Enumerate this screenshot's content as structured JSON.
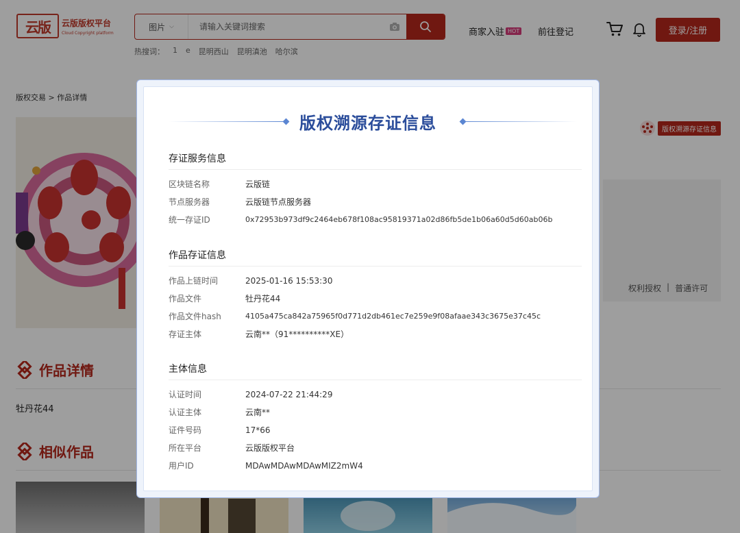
{
  "header": {
    "logo_seal": "云版",
    "logo_name": "云版版权平台",
    "logo_en": "Cloud Copyright platform",
    "search_category": "图片",
    "search_placeholder": "请输入关键词搜索",
    "hot_label": "热搜词：",
    "hot_words": [
      "1",
      "e",
      "昆明西山",
      "昆明滇池",
      "哈尔滨"
    ],
    "merchant_label": "商家入驻",
    "hot_badge": "HOT",
    "register_label": "前往登记",
    "login_label": "登录/注册"
  },
  "breadcrumb": "版权交易 > 作品详情",
  "trace_tag": "版权溯源存证信息",
  "license_links": [
    "权利授权",
    "|",
    "普通许可"
  ],
  "sections": {
    "detail_title": "作品详情",
    "work_name": "牡丹花44",
    "similar_title": "相似作品"
  },
  "modal": {
    "title": "版权溯源存证信息",
    "groups": [
      {
        "title": "存证服务信息",
        "rows": [
          {
            "k": "区块链名称",
            "v": "云版链"
          },
          {
            "k": "节点服务器",
            "v": "云版链节点服务器"
          },
          {
            "k": "统一存证ID",
            "v": "0x72953b973df9c2464eb678f108ac95819371a02d86fb5de1b06a60d5d60ab06b"
          }
        ]
      },
      {
        "title": "作品存证信息",
        "rows": [
          {
            "k": "作品上链时间",
            "v": "2025-01-16 15:53:30"
          },
          {
            "k": "作品文件",
            "v": "牡丹花44"
          },
          {
            "k": "作品文件hash",
            "v": "4105a475ca842a75965f0d771d2db461ec7e259e9f08afaae343c3675e37c45c"
          },
          {
            "k": "存证主体",
            "v": "云南**（91**********XE）"
          }
        ]
      },
      {
        "title": "主体信息",
        "rows": [
          {
            "k": "认证时间",
            "v": "2024-07-22 21:44:29"
          },
          {
            "k": "认证主体",
            "v": "云南**"
          },
          {
            "k": "证件号码",
            "v": "17*66"
          },
          {
            "k": "所在平台",
            "v": "云版版权平台"
          },
          {
            "k": "用户ID",
            "v": "MDAwMDAwMDAwMIZ2mW4"
          }
        ]
      }
    ]
  },
  "colors": {
    "brand_red": "#b5281c",
    "modal_title_blue": "#2b4d9b",
    "accent_blue": "#5b86d2"
  }
}
